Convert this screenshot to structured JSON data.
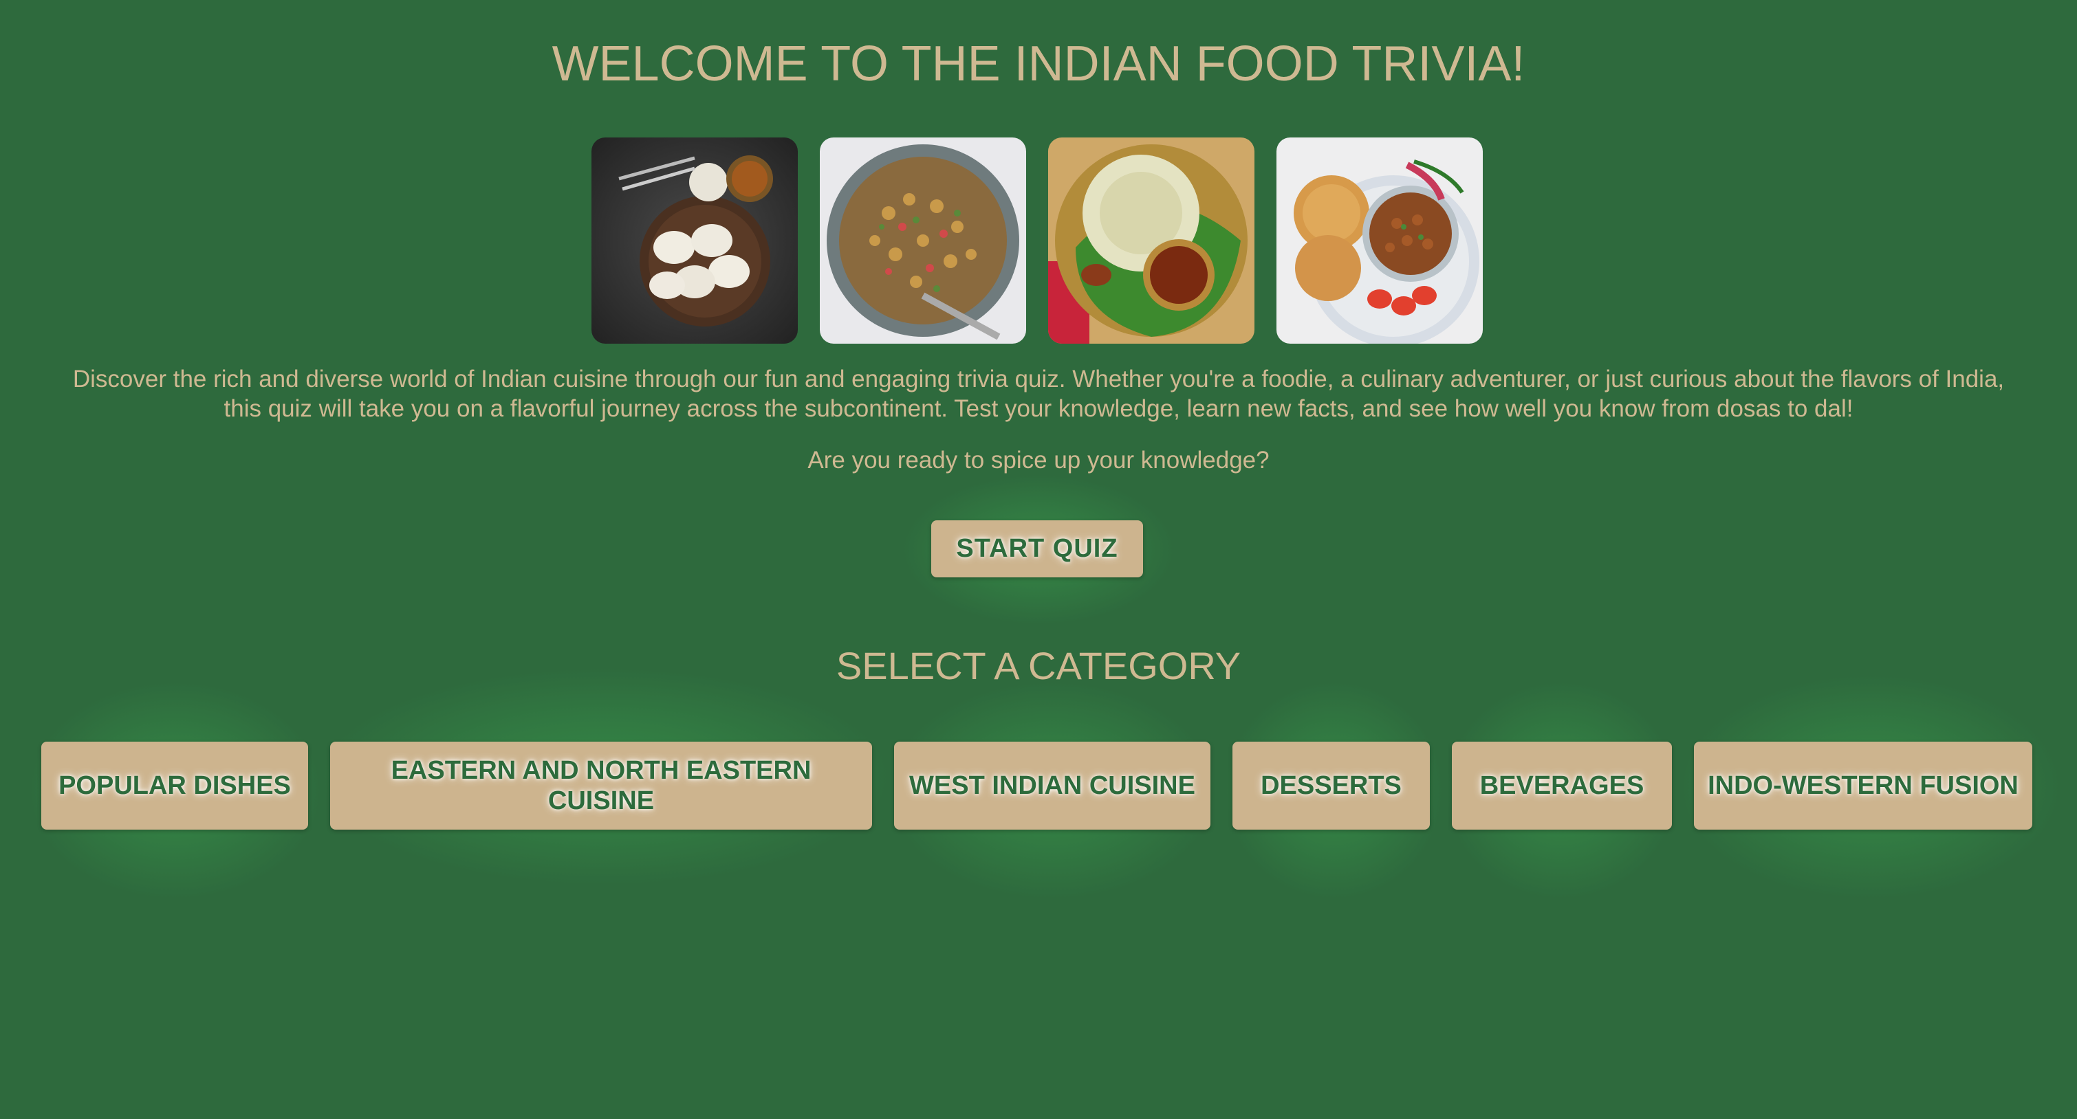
{
  "header": {
    "title": "WELCOME TO THE INDIAN FOOD TRIVIA!"
  },
  "gallery": {
    "images": [
      {
        "name": "idli-image"
      },
      {
        "name": "chana-chaat-image"
      },
      {
        "name": "appam-image"
      },
      {
        "name": "chole-bhature-image"
      }
    ]
  },
  "intro": {
    "text": "Discover the rich and diverse world of Indian cuisine through our fun and engaging trivia quiz. Whether you're a foodie, a culinary adventurer, or just curious about the flavors of India, this quiz will take you on a flavorful journey across the subcontinent. Test your knowledge, learn new facts, and see how well you know from dosas to dal!",
    "question": "Are you ready to spice up your knowledge?"
  },
  "actions": {
    "start_label": "START QUIZ"
  },
  "categories": {
    "heading": "SELECT A CATEGORY",
    "items": [
      {
        "label": "POPULAR DISHES"
      },
      {
        "label": "EASTERN AND NORTH EASTERN CUISINE"
      },
      {
        "label": "WEST INDIAN CUISINE"
      },
      {
        "label": "DESSERTS"
      },
      {
        "label": "BEVERAGES"
      },
      {
        "label": "INDO-WESTERN FUSION"
      }
    ]
  },
  "colors": {
    "background": "#2e6a3d",
    "text": "#cfb992",
    "button_bg": "#cdb48e",
    "button_text": "#2d6b3c"
  }
}
